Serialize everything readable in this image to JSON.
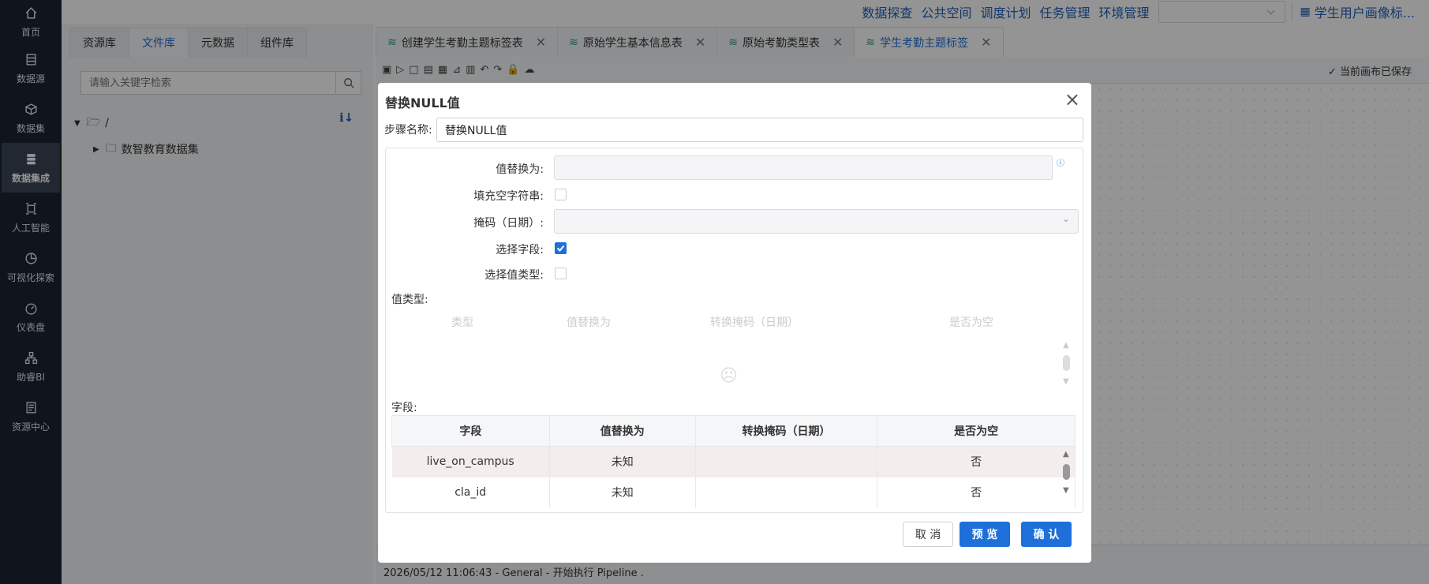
{
  "sidebar": {
    "items": [
      {
        "label": "首页",
        "icon": "home-icon"
      },
      {
        "label": "数据源",
        "icon": "datasource-icon"
      },
      {
        "label": "数据集",
        "icon": "dataset-icon"
      },
      {
        "label": "数据集成",
        "icon": "integration-icon"
      },
      {
        "label": "人工智能",
        "icon": "ai-icon"
      },
      {
        "label": "可视化探索",
        "icon": "chart-icon"
      },
      {
        "label": "仪表盘",
        "icon": "dashboard-icon"
      },
      {
        "label": "助睿BI",
        "icon": "bi-icon"
      },
      {
        "label": "资源中心",
        "icon": "resource-icon"
      }
    ],
    "active_index": 3
  },
  "topnav": {
    "links": [
      "数据探查",
      "公共空间",
      "调度计划",
      "任务管理",
      "环境管理"
    ],
    "project": "学生用户画像标..."
  },
  "left_panel": {
    "tabs": [
      "资源库",
      "文件库",
      "元数据",
      "组件库"
    ],
    "active_tab": 1,
    "search_placeholder": "请输入关键字检索",
    "tree_root": "/",
    "tree_child": "数智教育数据集",
    "sort_icon": "ℹ↓"
  },
  "editor_tabs": [
    {
      "label": "创建学生考勤主题标签表"
    },
    {
      "label": "原始学生基本信息表"
    },
    {
      "label": "原始考勤类型表"
    },
    {
      "label": "学生考勤主题标签"
    }
  ],
  "toolbar": {
    "saved_text": "当前画布已保存"
  },
  "log": {
    "line": "2026/05/12 11:06:43 - General - 开始执行 Pipeline ."
  },
  "dialog": {
    "title": "替换NULL值",
    "step_label": "步骤名称:",
    "step_value": "替换NULL值",
    "fields": {
      "replace_with": "值替换为:",
      "fill_empty": "填充空字符串:",
      "mask": "掩码（日期）:",
      "select_field": "选择字段:",
      "select_type": "选择值类型:"
    },
    "select_field_checked": true,
    "value_type_section": "值类型:",
    "value_type_columns": [
      "类型",
      "值替换为",
      "转换掩码（日期）",
      "是否为空"
    ],
    "field_section": "字段:",
    "field_columns": [
      "字段",
      "值替换为",
      "转换掩码（日期）",
      "是否为空"
    ],
    "field_rows": [
      {
        "field": "live_on_campus",
        "replace": "未知",
        "mask": "",
        "empty": "否"
      },
      {
        "field": "cla_id",
        "replace": "未知",
        "mask": "",
        "empty": "否"
      }
    ],
    "buttons": {
      "cancel": "取 消",
      "preview": "预 览",
      "confirm": "确 认"
    }
  }
}
